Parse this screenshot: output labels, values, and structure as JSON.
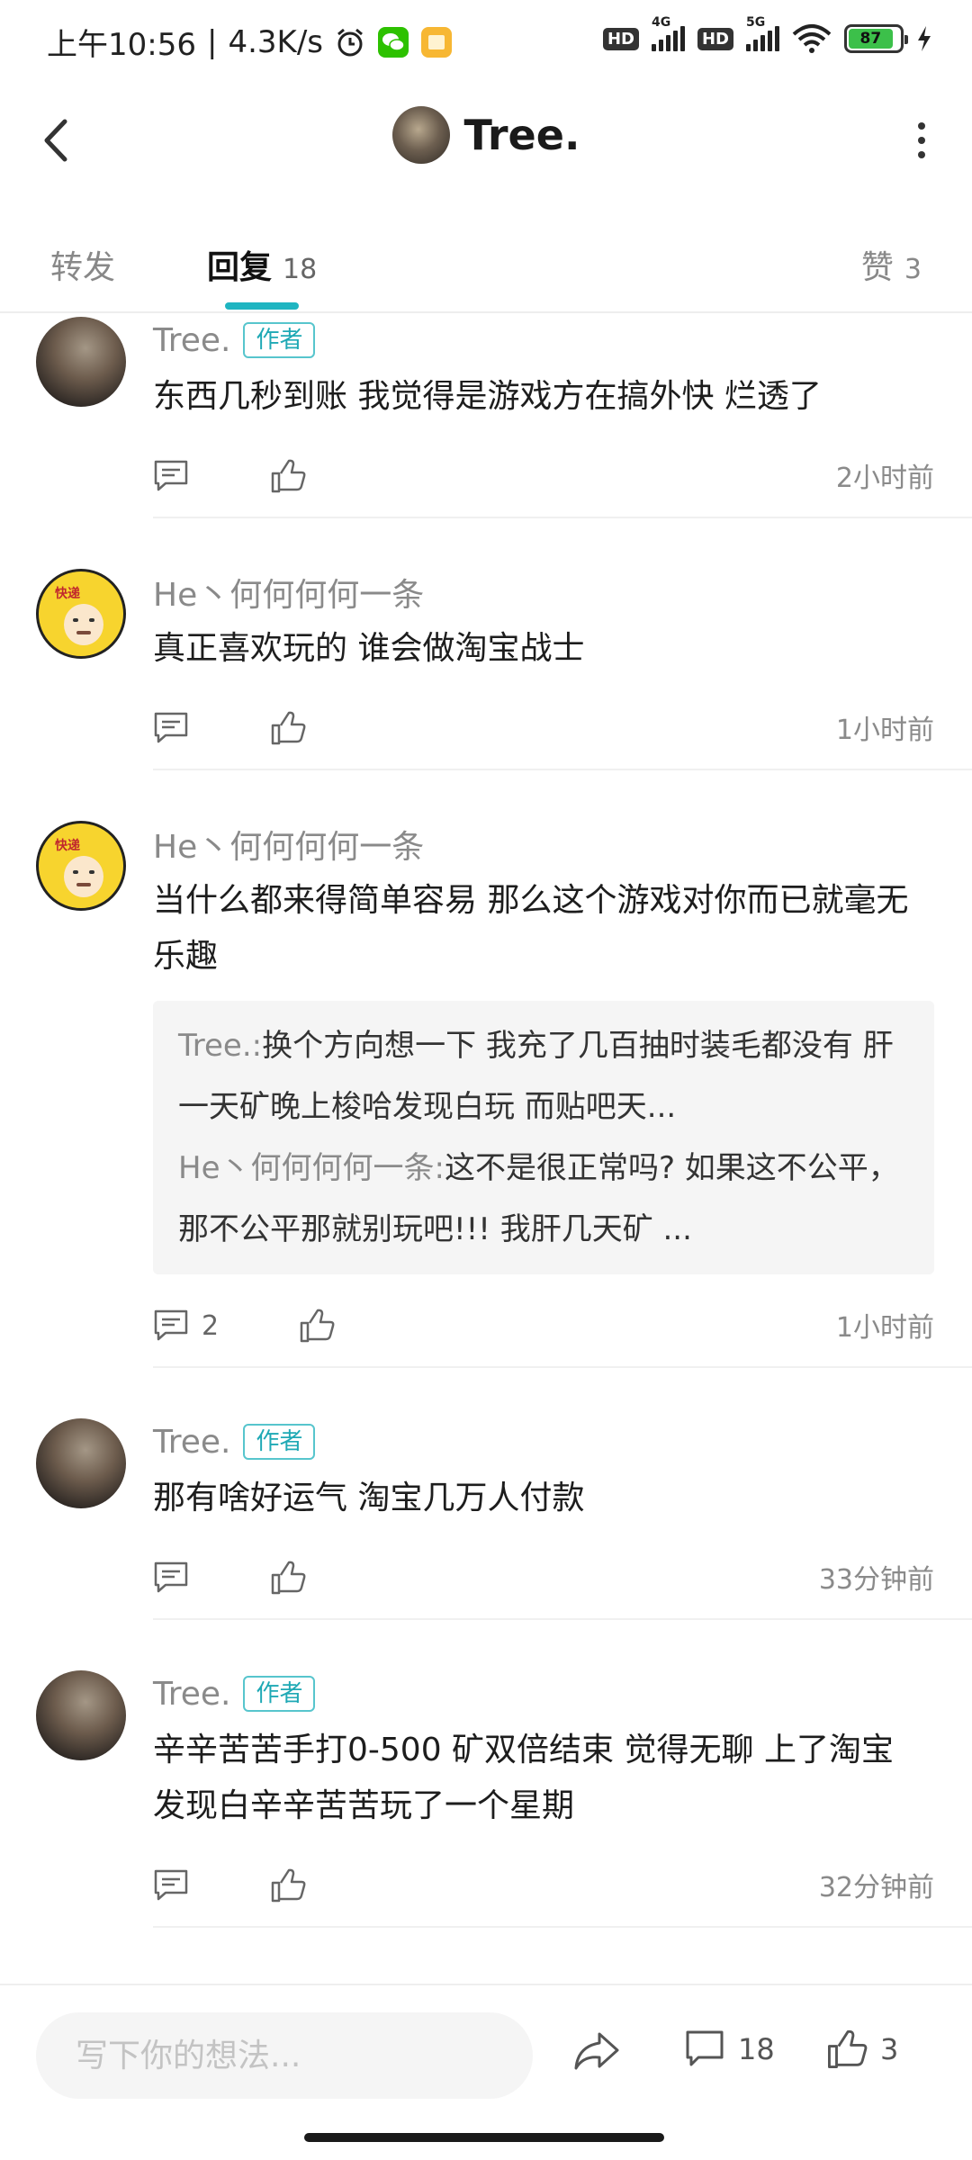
{
  "status_bar": {
    "time": "上午10:56",
    "separator": "|",
    "net_speed": "4.3K/s",
    "net_label_1": "4G",
    "net_label_2": "5G",
    "hd_label": "HD",
    "battery": "87"
  },
  "header": {
    "title": "Tree."
  },
  "tabs": {
    "repost": {
      "label": "转发"
    },
    "reply": {
      "label": "回复",
      "count": "18"
    },
    "like": {
      "label": "赞",
      "count": "3"
    }
  },
  "comments": [
    {
      "name": "Tree.",
      "badge": "作者",
      "text": "东西几秒到账  我觉得是游戏方在搞外快  烂透了",
      "time": "2小时前"
    },
    {
      "name": "He丶何何何何一条",
      "text": "真正喜欢玩的  谁会做淘宝战士",
      "time": "1小时前"
    },
    {
      "name": "He丶何何何何一条",
      "text": "当什么都来得简单容易  那么这个游戏对你而已就毫无乐趣",
      "time": "1小时前",
      "reply_count": "2",
      "sub_replies": [
        {
          "name": "Tree.",
          "sep": ":",
          "text": "换个方向想一下  我充了几百抽时装毛都没有  肝一天矿晚上梭哈发现白玩  而贴吧天..."
        },
        {
          "name": "He丶何何何何一条",
          "sep": ":",
          "text": "这不是很正常吗? 如果这不公平，那不公平那就别玩吧!!! 我肝几天矿 ..."
        }
      ]
    },
    {
      "name": "Tree.",
      "badge": "作者",
      "text": "那有啥好运气  淘宝几万人付款",
      "time": "33分钟前"
    },
    {
      "name": "Tree.",
      "badge": "作者",
      "text": "辛辛苦苦手打0-500  矿双倍结束  觉得无聊  上了淘宝  发现白辛辛苦苦玩了一个星期",
      "time": "32分钟前"
    }
  ],
  "bottom_bar": {
    "input_placeholder": "写下你的想法...",
    "comment_count": "18",
    "like_count": "3"
  }
}
